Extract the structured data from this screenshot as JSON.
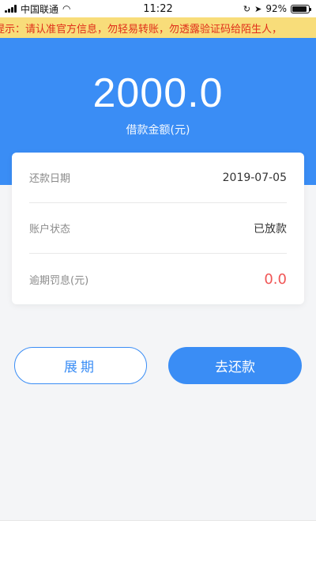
{
  "status_bar": {
    "carrier": "中国联通",
    "time": "11:22",
    "battery": "92%",
    "battery_level": 0.92
  },
  "notice": {
    "text": "提示：请认准官方信息，勿轻易转账，勿透露验证码给陌生人，"
  },
  "loan": {
    "amount": "2000.0",
    "amount_label": "借款金额(元)"
  },
  "details": [
    {
      "label": "还款日期",
      "value": "2019-07-05"
    },
    {
      "label": "账户状态",
      "value": "已放款"
    },
    {
      "label": "逾期罚息(元)",
      "value": "0.0"
    }
  ],
  "actions": {
    "extend_label": "展期",
    "repay_label": "去还款"
  },
  "colors": {
    "primary": "#3a8df5",
    "notice_bg": "#f8dd7a",
    "notice_text": "#e02f1a",
    "penalty": "#f05656"
  }
}
